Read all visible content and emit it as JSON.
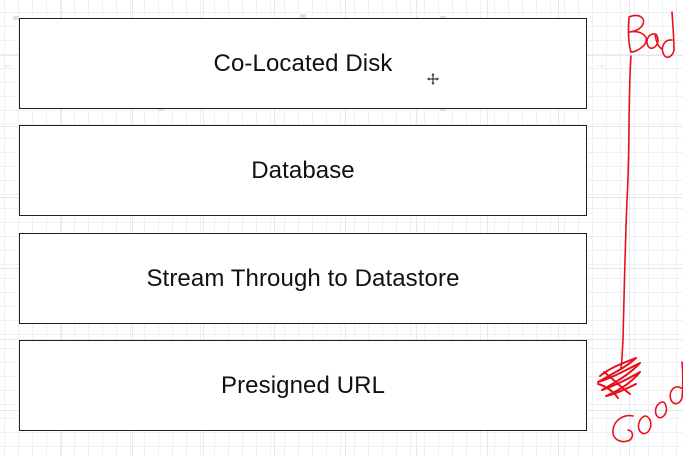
{
  "diagram": {
    "boxes": [
      {
        "label": "Co-Located Disk"
      },
      {
        "label": "Database"
      },
      {
        "label": "Stream Through to Datastore"
      },
      {
        "label": "Presigned URL"
      }
    ],
    "annotation": {
      "top_label": "Bad",
      "bottom_label": "Good",
      "color": "#e8111b"
    },
    "box_border_color": "#1f1f1f",
    "grid_color": "#e1e8ef",
    "selection_color": "#cfe4fb"
  }
}
